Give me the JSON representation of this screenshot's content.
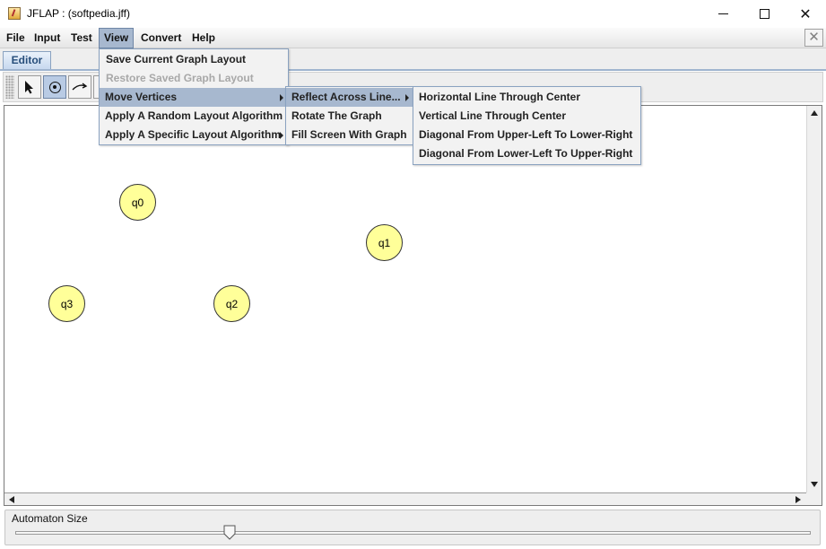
{
  "window": {
    "title": "JFLAP : (softpedia.jff)",
    "controls": {
      "minimize": "minimize-icon",
      "maximize": "maximize-icon",
      "close": "close-icon"
    }
  },
  "menubar": {
    "items": [
      "File",
      "Input",
      "Test",
      "View",
      "Convert",
      "Help"
    ],
    "active": "View"
  },
  "tabs": [
    {
      "label": "Editor",
      "selected": true
    }
  ],
  "toolbar": {
    "tools": [
      "attribute-editor-tool",
      "state-creator-tool",
      "transition-creator-tool"
    ],
    "selected": "state-creator-tool"
  },
  "view_menu": {
    "items": [
      {
        "label": "Save Current Graph Layout"
      },
      {
        "label": "Restore Saved Graph Layout",
        "disabled": true
      },
      {
        "label": "Move Vertices",
        "submenu": true,
        "highlighted": true
      },
      {
        "label": "Apply A Random Layout Algorithm"
      },
      {
        "label": "Apply A Specific Layout Algorithm",
        "submenu": true
      }
    ]
  },
  "move_vertices_menu": {
    "items": [
      {
        "label": "Reflect Across Line...",
        "submenu": true,
        "highlighted": true
      },
      {
        "label": "Rotate The Graph"
      },
      {
        "label": "Fill Screen With Graph"
      }
    ]
  },
  "reflect_menu": {
    "items": [
      {
        "label": "Horizontal Line Through Center"
      },
      {
        "label": "Vertical Line Through Center"
      },
      {
        "label": "Diagonal From Upper-Left To Lower-Right"
      },
      {
        "label": "Diagonal From Lower-Left To Upper-Right"
      }
    ]
  },
  "states": [
    "q0",
    "q1",
    "q2",
    "q3"
  ],
  "size_panel": {
    "label": "Automaton Size",
    "slider_value_fraction": 0.27
  },
  "colors": {
    "state_fill": "#ffff99",
    "menu_highlight": "#a7b8cf",
    "tab_text": "#264d7a"
  }
}
